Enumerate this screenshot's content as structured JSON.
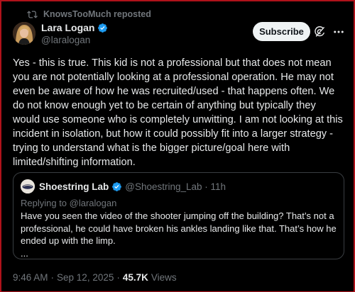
{
  "repost": {
    "text": "KnowsTooMuch reposted",
    "icon": "repost-icon"
  },
  "author": {
    "display_name": "Lara Logan",
    "handle": "@laralogan",
    "verified": true
  },
  "header": {
    "subscribe_label": "Subscribe",
    "grok_icon": "grok-icon",
    "more_icon": "more-icon"
  },
  "tweet": {
    "text": "Yes - this is true. This kid is not a professional but that does not mean\nyou are not potentially looking at a professional operation. He may not\neven be aware of how he was recruited/used - that happens often. We\ndo not know enough yet to be certain of anything but typically they\nwould use someone who is completely unwitting. I am not looking at this\nincident in isolation, but how it could possibly fit into a larger strategy -\ntrying to understand what is the bigger picture/goal here with\nlimited/shifting information."
  },
  "quote": {
    "display_name": "Shoestring Lab",
    "handle_time": "@Shoestring_Lab · 11h",
    "replying_prefix": "Replying to ",
    "replying_handle": "@laralogan",
    "text": "Have you seen the video of the shooter jumping off the building? That’s not a\nprofessional, he could have broken his ankles landing like that. That’s how he\nended up with the limp.\n..."
  },
  "meta": {
    "time": "9:46 AM",
    "date": "Sep 12, 2025",
    "separator": "·",
    "views_count": "45.7K",
    "views_label": "Views"
  },
  "colors": {
    "background": "#000000",
    "text": "#e7e9ea",
    "muted": "#71767b",
    "verified": "#1d9bf0",
    "frame": "#b0121b"
  }
}
